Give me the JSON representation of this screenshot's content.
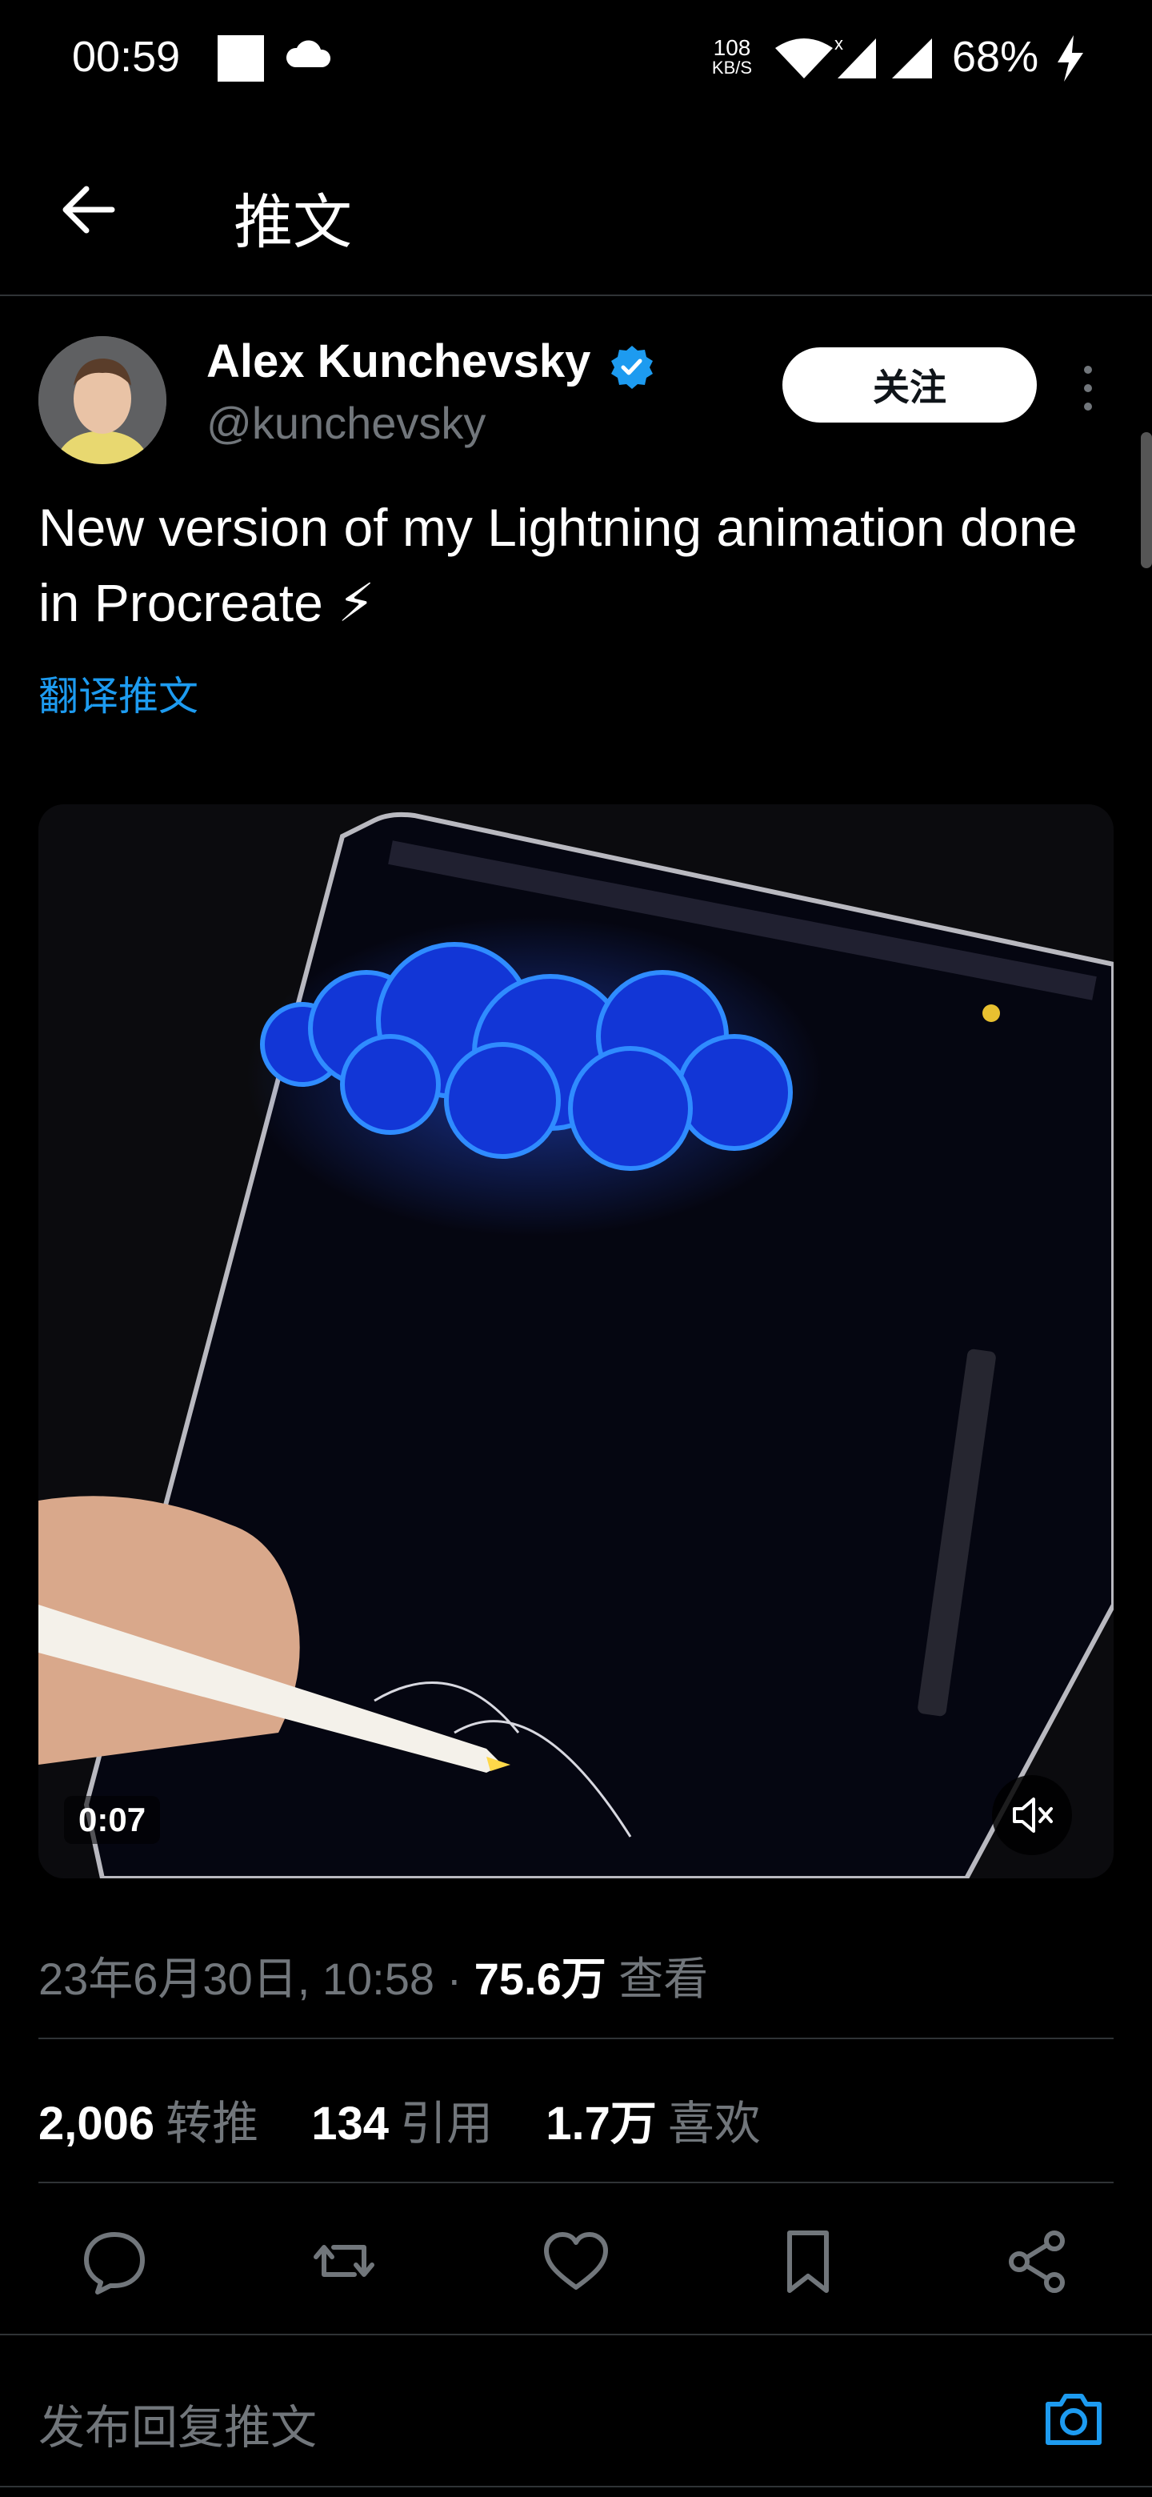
{
  "status_bar": {
    "time": "00:59",
    "net_speed_top": "108",
    "net_speed_bottom": "KB/S",
    "battery": "68%"
  },
  "header": {
    "title": "推文"
  },
  "tweet": {
    "author_name": "Alex Kunchevsky",
    "author_handle": "@kunchevsky",
    "follow_label": "关注",
    "text": "New version of my Lightning animation done in Procreate ⚡",
    "translate_label": "翻译推文",
    "video_time": "0:07",
    "date": "23年6月30日, 10:58 · ",
    "views_count": "75.6万",
    "views_label": " 查看"
  },
  "stats": {
    "retweets_count": "2,006",
    "retweets_label": "转推",
    "quotes_count": "134",
    "quotes_label": "引用",
    "likes_count": "1.7万",
    "likes_label": "喜欢"
  },
  "reply": {
    "placeholder": "发布回复推文"
  },
  "icons": {
    "accent": "#1d9bf0"
  }
}
